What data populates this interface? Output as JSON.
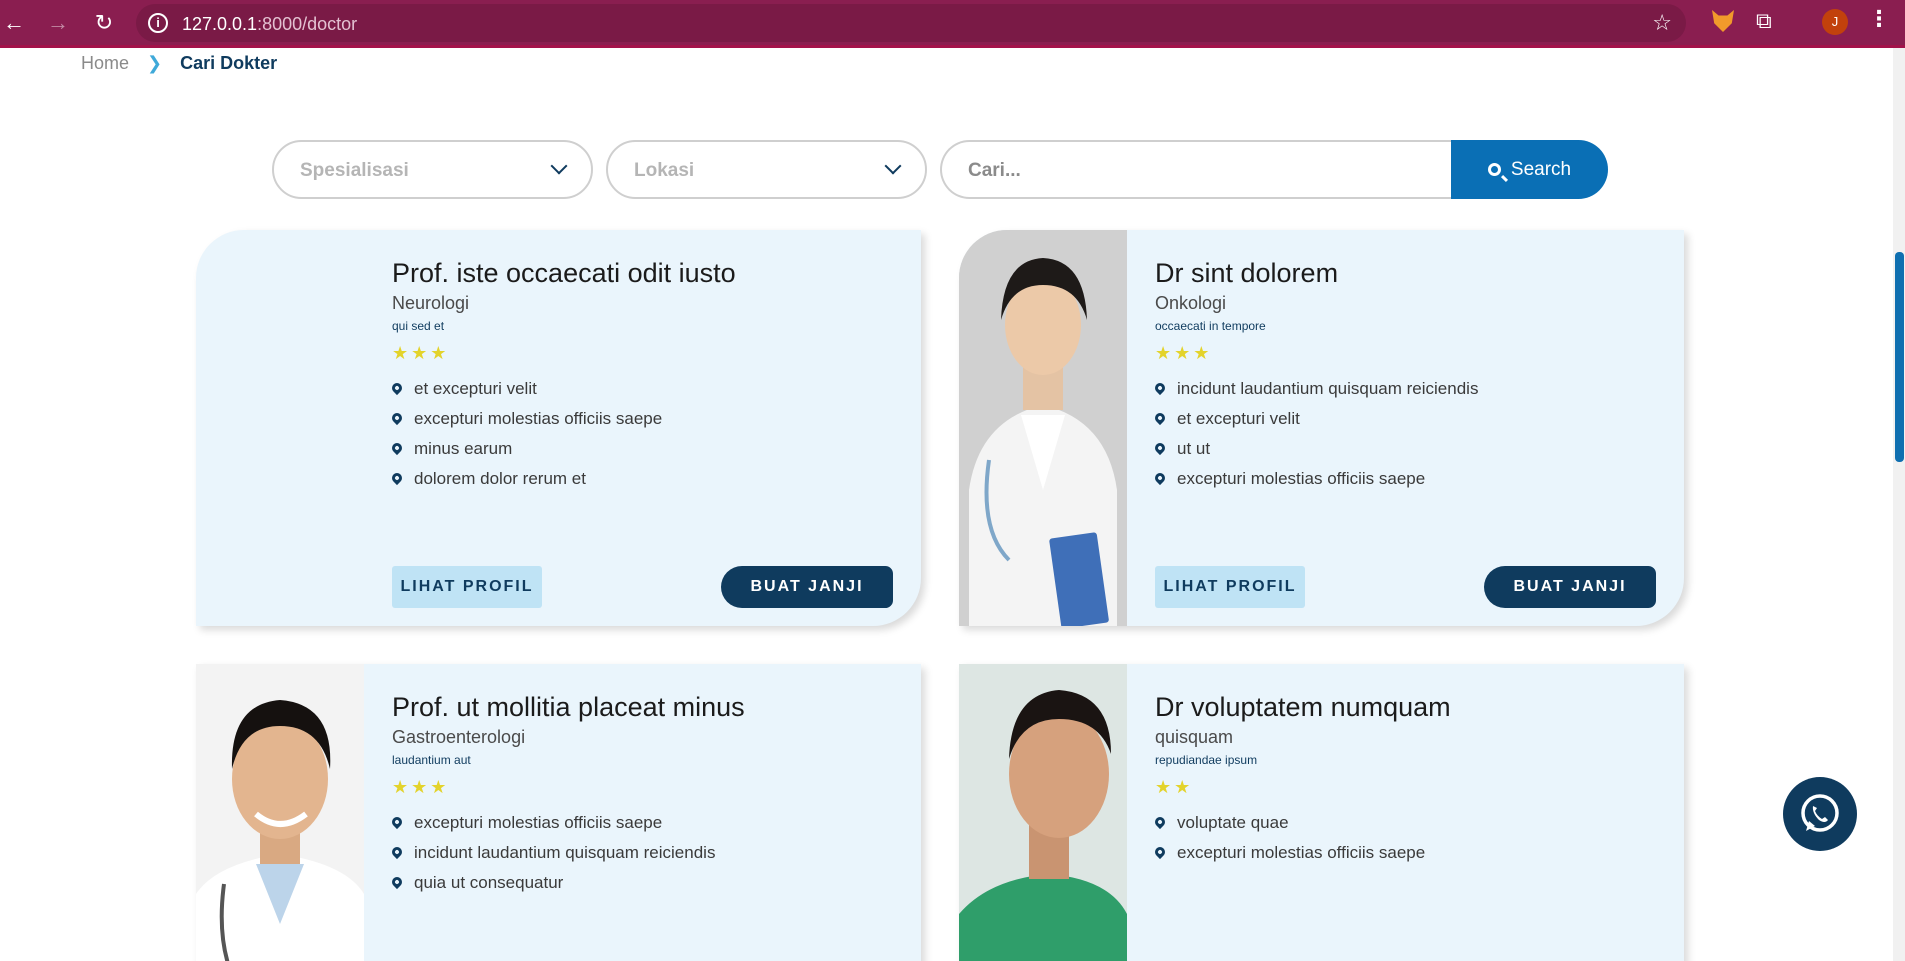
{
  "browser": {
    "url_host": "127.0.0.1",
    "url_path": ":8000/doctor",
    "avatar_initial": "J"
  },
  "breadcrumb": {
    "home": "Home",
    "current": "Cari Dokter"
  },
  "filters": {
    "specialization_placeholder": "Spesialisasi",
    "location_placeholder": "Lokasi",
    "search_placeholder": "Cari...",
    "search_button": "Search"
  },
  "cards": [
    {
      "name": "Prof. iste occaecati odit iusto",
      "specialty": "Neurologi",
      "subtitle": "qui sed et",
      "rating": 3,
      "stars": "★★★",
      "locations": [
        "et excepturi velit",
        "excepturi molestias officiis saepe",
        "minus earum",
        "dolorem dolor rerum et"
      ],
      "profile_button": "LIHAT PROFIL",
      "appointment_button": "BUAT JANJI"
    },
    {
      "name": "Dr sint dolorem",
      "specialty": "Onkologi",
      "subtitle": "occaecati in tempore",
      "rating": 3,
      "stars": "★★★",
      "locations": [
        "incidunt laudantium quisquam reiciendis",
        "et excepturi velit",
        "ut ut",
        "excepturi molestias officiis saepe"
      ],
      "profile_button": "LIHAT PROFIL",
      "appointment_button": "BUAT JANJI"
    },
    {
      "name": "Prof. ut mollitia placeat minus",
      "specialty": "Gastroenterologi",
      "subtitle": "laudantium aut",
      "rating": 3,
      "stars": "★★★",
      "locations": [
        "excepturi molestias officiis saepe",
        "incidunt laudantium quisquam reiciendis",
        "quia ut consequatur"
      ]
    },
    {
      "name": "Dr voluptatem numquam",
      "specialty": "quisquam",
      "subtitle": "repudiandae ipsum",
      "rating": 2,
      "stars": "★★",
      "locations": [
        "voluptate quae",
        "excepturi molestias officiis saepe"
      ]
    }
  ],
  "colors": {
    "brand_navy": "#0f3b5e",
    "search_blue": "#0a6fb5",
    "card_bg": "#eaf5fc",
    "star_yellow": "#e3d32b",
    "browser_bar": "#8a1e50"
  },
  "icons": [
    "back-arrow-icon",
    "forward-arrow-icon",
    "reload-icon",
    "info-icon",
    "bookmark-star-icon",
    "extension-fox-icon",
    "extensions-puzzle-icon",
    "menu-dots-icon",
    "chevron-right-icon",
    "chevron-down-icon",
    "search-icon",
    "location-pin-icon",
    "star-icon",
    "whatsapp-icon"
  ]
}
